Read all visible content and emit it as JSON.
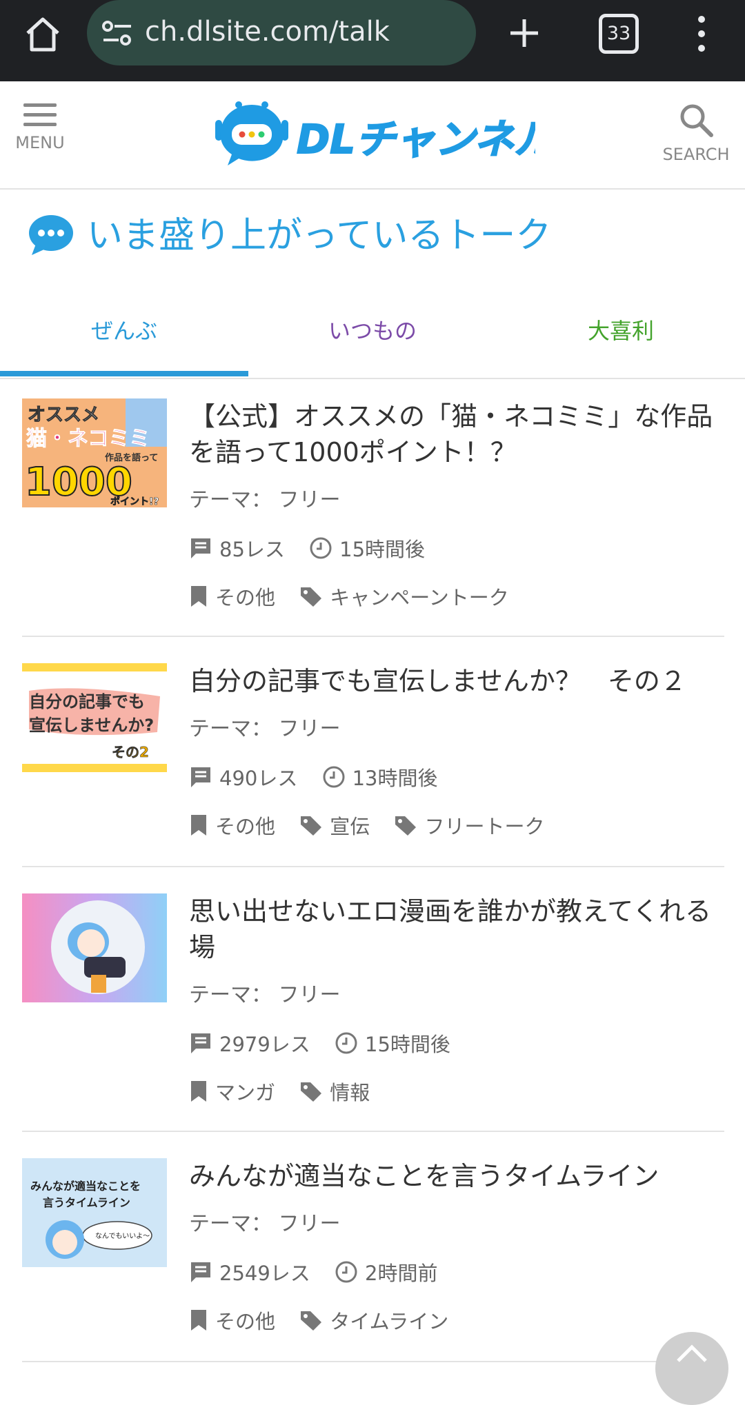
{
  "browser": {
    "url": "ch.dlsite.com/talk",
    "tab_count": "33"
  },
  "header": {
    "menu_label": "MENU",
    "logo_text": "DLチャンネル",
    "search_label": "SEARCH"
  },
  "section": {
    "title": "いま盛り上がっているトーク"
  },
  "tabs": [
    {
      "label": "ぜんぶ",
      "active": true,
      "color": "#2a9ad8"
    },
    {
      "label": "いつもの",
      "active": false,
      "color": "#7c4ba8"
    },
    {
      "label": "大喜利",
      "active": false,
      "color": "#44a32c"
    }
  ],
  "talks": [
    {
      "title": "【公式】オススメの「猫・ネコミミ」な作品を語って1000ポイント！？",
      "theme": "テーマ： フリー",
      "replies": "85レス",
      "time": "15時間後",
      "category": "その他",
      "tags": [
        "キャンペーントーク"
      ],
      "thumb_text": [
        "オススメ",
        "猫・ネコミミ",
        "作品を語って",
        "1000",
        "ポイント!?"
      ]
    },
    {
      "title": "自分の記事でも宣伝しませんか？　その２",
      "theme": "テーマ： フリー",
      "replies": "490レス",
      "time": "13時間後",
      "category": "その他",
      "tags": [
        "宣伝",
        "フリートーク"
      ],
      "thumb_text": [
        "自分の記事でも",
        "宣伝しませんか?",
        "その2"
      ]
    },
    {
      "title": "思い出せないエロ漫画を誰かが教えてくれる場",
      "theme": "テーマ： フリー",
      "replies": "2979レス",
      "time": "15時間後",
      "category": "マンガ",
      "tags": [
        "情報"
      ],
      "thumb_text": []
    },
    {
      "title": "みんなが適当なことを言うタイムライン",
      "theme": "テーマ： フリー",
      "replies": "2549レス",
      "time": "2時間前",
      "category": "その他",
      "tags": [
        "タイムライン"
      ],
      "thumb_text": [
        "みんなが適当なことを",
        "言うタイムライン",
        "なんでもいいよ〜"
      ]
    }
  ]
}
